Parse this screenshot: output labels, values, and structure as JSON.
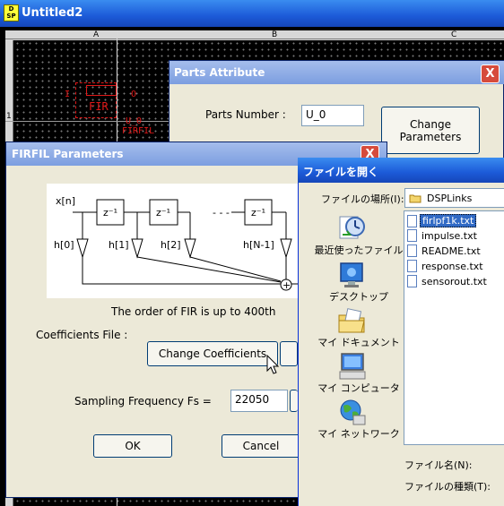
{
  "main_window": {
    "title": "Untitled2",
    "app_icon_text": [
      "D",
      "SP"
    ]
  },
  "sheet": {
    "columns": [
      "A",
      "B",
      "C"
    ],
    "rows": [
      "1"
    ],
    "part": {
      "block_label": "FIR",
      "instance_label": "U_0",
      "type_label": "FIRFIL",
      "in_pin": "I",
      "out_pin": "O"
    }
  },
  "parts_attribute": {
    "title": "Parts Attribute",
    "close_glyph": "X",
    "parts_number_label": "Parts Number :",
    "parts_number_value": "U_0",
    "change_button": "Change Parameters"
  },
  "firfil": {
    "title": "FIRFIL Parameters",
    "close_glyph": "X",
    "diagram": {
      "input": "x[n]",
      "delay": "z⁻¹",
      "ellipsis": "- - -",
      "taps": [
        "h[0]",
        "h[1]",
        "h[2]",
        "h[N-1]"
      ],
      "sum": "+"
    },
    "order_note": "The order of FIR is up to 400th",
    "coeff_label": "Coefficients File :",
    "change_coeff_button": "Change Coefficients",
    "fs_label": "Sampling Frequency Fs =",
    "fs_value": "22050",
    "ok_button": "OK",
    "cancel_button": "Cancel"
  },
  "open_dialog": {
    "title": "ファイルを開く",
    "look_in_label": "ファイルの場所(I):",
    "look_in_value": "DSPLinks",
    "places": [
      "最近使ったファイル",
      "デスクトップ",
      "マイ ドキュメント",
      "マイ コンピュータ",
      "マイ ネットワーク"
    ],
    "files": [
      "firlpf1k.txt",
      "impulse.txt",
      "README.txt",
      "response.txt",
      "sensorout.txt"
    ],
    "selected_index": 0,
    "filename_label": "ファイル名(N):",
    "filetype_label": "ファイルの種類(T):"
  }
}
